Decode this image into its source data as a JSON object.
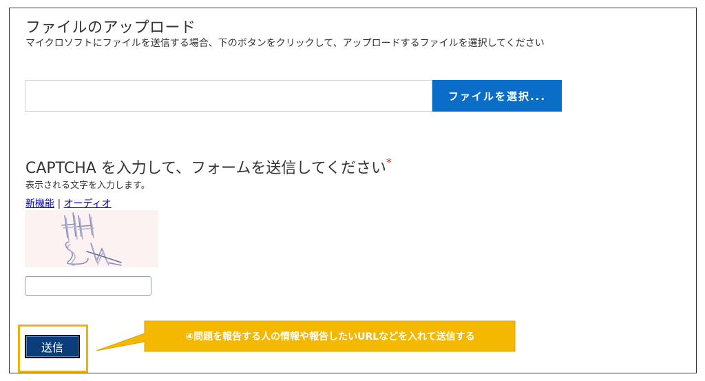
{
  "upload": {
    "title": "ファイルのアップロード",
    "description": "マイクロソフトにファイルを送信する場合、下のボタンをクリックして、アップロードするファイルを選択してください",
    "file_value": "",
    "choose_button_label": "ファイルを選択..."
  },
  "captcha": {
    "title": "CAPTCHA を入力して、フォームを送信してください",
    "required_marker": "*",
    "description": "表示される文字を入力します。",
    "link_new": "新機能",
    "separator": "|",
    "link_audio": "オーディオ",
    "image_text": "HH5W",
    "input_value": ""
  },
  "form": {
    "submit_label": "送信"
  },
  "annotation": {
    "callout_text": "④問題を報告する人の情報や報告したいURLなどを入れて送信する",
    "highlight_color": "#f0b400",
    "callout_color": "#f5b800"
  },
  "colors": {
    "primary_button": "#0a6ec8",
    "submit_button": "#0a3d7a",
    "link": "#0000cc",
    "required": "#c0392b"
  }
}
